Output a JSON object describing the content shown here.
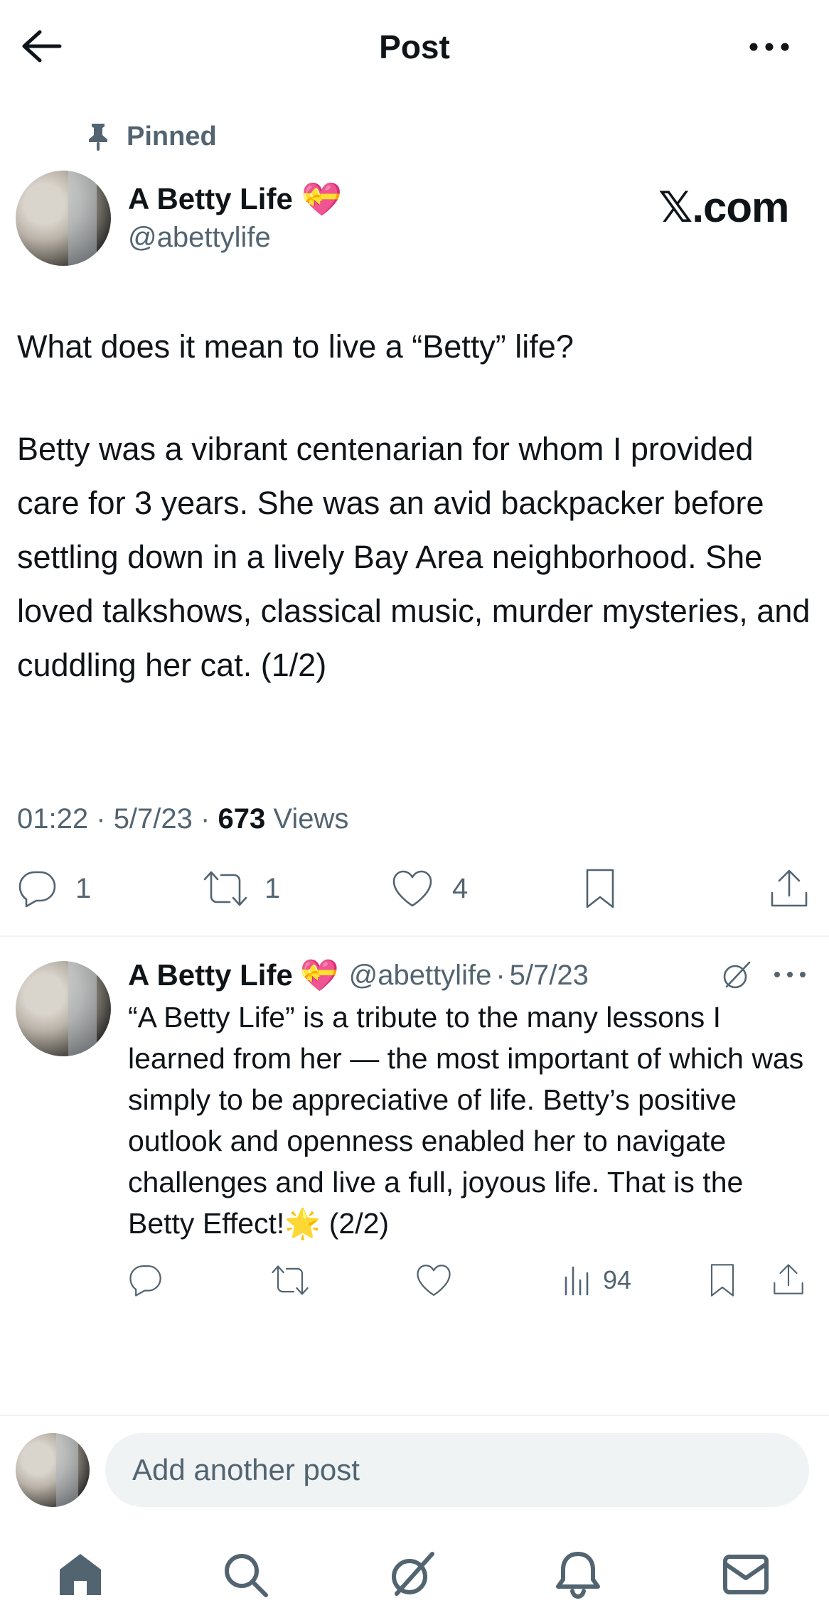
{
  "header": {
    "title": "Post"
  },
  "pinned": {
    "label": "Pinned"
  },
  "main_post": {
    "display_name": "A Betty Life",
    "name_emoji": "💝",
    "handle": "@abettylife",
    "watermark": "𝕏.com",
    "text_line1": "What does it mean to live a “Betty” life?",
    "text_body": "Betty was a vibrant centenarian for whom I provided care for 3 years. She was an avid backpacker before settling down in a lively Bay Area neighborhood. She loved talkshows, classical music, murder mysteries, and cuddling her cat. (1/2)",
    "time": "01:22",
    "date": "5/7/23",
    "views_count": "673",
    "views_label": "Views",
    "dot": "·",
    "reply_count": "1",
    "repost_count": "1",
    "like_count": "4"
  },
  "reply_post": {
    "display_name": "A Betty Life",
    "name_emoji": "💝",
    "handle": "@abettylife",
    "date": "5/7/23",
    "text": "“A Betty Life” is a tribute to the many lessons I learned from her — the most important of which was simply to be appreciative of life. Betty’s positive outlook and openness enabled her to navigate challenges and live a full, joyous life. That is the Betty Effect!🌟 (2/2)",
    "views_count": "94"
  },
  "composer": {
    "placeholder": "Add another post"
  },
  "icons": [
    "back-arrow-icon",
    "more-icon",
    "pin-icon",
    "reply-icon",
    "repost-icon",
    "like-icon",
    "bookmark-icon",
    "share-icon",
    "grok-icon",
    "analytics-icon",
    "home-icon",
    "search-icon",
    "notifications-icon",
    "messages-icon"
  ],
  "colors": {
    "text": "#0f1419",
    "muted": "#536471",
    "divider": "#eff3f4",
    "input_bg": "#eff3f4"
  }
}
